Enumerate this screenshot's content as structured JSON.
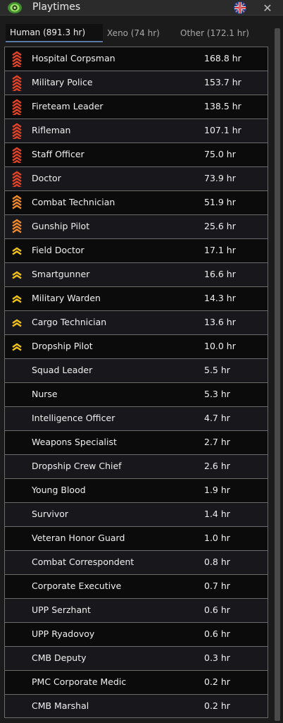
{
  "window": {
    "title": "Playtimes",
    "close_label": "✕"
  },
  "tabs": [
    {
      "label": "Human (891.3 hr)",
      "active": true
    },
    {
      "label": "Xeno (74 hr)",
      "active": false
    },
    {
      "label": "Other (172.1 hr)",
      "active": false
    }
  ],
  "rank_colors": {
    "red": "#e2442a",
    "orange": "#ef8a2c",
    "yellow": "#f2c21a"
  },
  "rows": [
    {
      "name": "Hospital Corpsman",
      "time": "168.8 hr",
      "rank": "red"
    },
    {
      "name": "Military Police",
      "time": "153.7 hr",
      "rank": "red"
    },
    {
      "name": "Fireteam Leader",
      "time": "138.5 hr",
      "rank": "red"
    },
    {
      "name": "Rifleman",
      "time": "107.1 hr",
      "rank": "red"
    },
    {
      "name": "Staff Officer",
      "time": "75.0 hr",
      "rank": "red"
    },
    {
      "name": "Doctor",
      "time": "73.9 hr",
      "rank": "red"
    },
    {
      "name": "Combat Technician",
      "time": "51.9 hr",
      "rank": "orange"
    },
    {
      "name": "Gunship Pilot",
      "time": "25.6 hr",
      "rank": "orange"
    },
    {
      "name": "Field Doctor",
      "time": "17.1 hr",
      "rank": "yellow"
    },
    {
      "name": "Smartgunner",
      "time": "16.6 hr",
      "rank": "yellow"
    },
    {
      "name": "Military Warden",
      "time": "14.3 hr",
      "rank": "yellow"
    },
    {
      "name": "Cargo Technician",
      "time": "13.6 hr",
      "rank": "yellow"
    },
    {
      "name": "Dropship Pilot",
      "time": "10.0 hr",
      "rank": "yellow"
    },
    {
      "name": "Squad Leader",
      "time": "5.5 hr",
      "rank": ""
    },
    {
      "name": "Nurse",
      "time": "5.3 hr",
      "rank": ""
    },
    {
      "name": "Intelligence Officer",
      "time": "4.7 hr",
      "rank": ""
    },
    {
      "name": "Weapons Specialist",
      "time": "2.7 hr",
      "rank": ""
    },
    {
      "name": "Dropship Crew Chief",
      "time": "2.6 hr",
      "rank": ""
    },
    {
      "name": "Young Blood",
      "time": "1.9 hr",
      "rank": ""
    },
    {
      "name": "Survivor",
      "time": "1.4 hr",
      "rank": ""
    },
    {
      "name": "Veteran Honor Guard",
      "time": "1.0 hr",
      "rank": ""
    },
    {
      "name": "Combat Correspondent",
      "time": "0.8 hr",
      "rank": ""
    },
    {
      "name": "Corporate Executive",
      "time": "0.7 hr",
      "rank": ""
    },
    {
      "name": "UPP Serzhant",
      "time": "0.6 hr",
      "rank": ""
    },
    {
      "name": "UPP Ryadovoy",
      "time": "0.6 hr",
      "rank": ""
    },
    {
      "name": "CMB Deputy",
      "time": "0.3 hr",
      "rank": ""
    },
    {
      "name": "PMC Corporate Medic",
      "time": "0.2 hr",
      "rank": ""
    },
    {
      "name": "CMB Marshal",
      "time": "0.2 hr",
      "rank": ""
    }
  ]
}
